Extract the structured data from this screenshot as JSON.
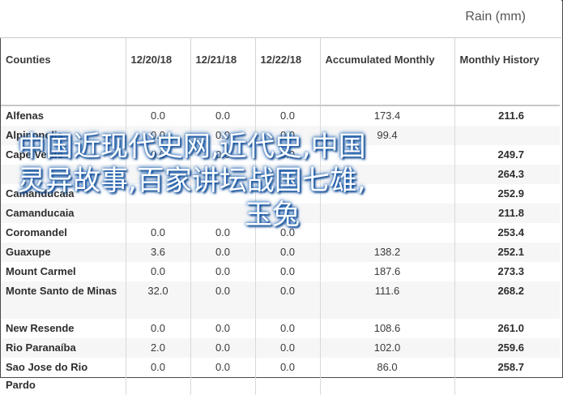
{
  "header": {
    "title": "Rain (mm)"
  },
  "table": {
    "columns": [
      "Counties",
      "12/20/18",
      "12/21/18",
      "12/22/18",
      "Accumulated Monthly",
      "Monthly History"
    ],
    "rows": [
      {
        "county": "Alfenas",
        "d1": "0.0",
        "d2": "0.0",
        "d3": "0.0",
        "acc": "173.4",
        "hist": "211.6"
      },
      {
        "county": "Alpinopolis",
        "d1": "0.0",
        "d2": "0.0",
        "d3": "0.0",
        "acc": "99.4",
        "hist": ""
      },
      {
        "county": "Cape Verde",
        "d1": "0.0",
        "d2": "0.0",
        "d3": "0.0",
        "acc": "",
        "hist": "249.7"
      },
      {
        "county": "",
        "d1": "",
        "d2": "",
        "d3": "",
        "acc": "",
        "hist": "264.3"
      },
      {
        "county": "Camanducaia",
        "d1": "",
        "d2": "",
        "d3": "",
        "acc": "",
        "hist": "252.9"
      },
      {
        "county": "Camanducaia",
        "d1": "",
        "d2": "",
        "d3": "",
        "acc": "",
        "hist": "211.8"
      },
      {
        "county": "Coromandel",
        "d1": "0.0",
        "d2": "0.0",
        "d3": "0.0",
        "acc": "",
        "hist": "253.4"
      },
      {
        "county": "Guaxupe",
        "d1": "3.6",
        "d2": "0.0",
        "d3": "0.0",
        "acc": "138.2",
        "hist": "252.1"
      },
      {
        "county": "Mount Carmel",
        "d1": "0.0",
        "d2": "0.0",
        "d3": "0.0",
        "acc": "187.6",
        "hist": "273.3"
      },
      {
        "county": "Monte Santo de Minas",
        "d1": "32.0",
        "d2": "0.0",
        "d3": "0.0",
        "acc": "111.6",
        "hist": "268.2"
      },
      {
        "county": "New Resende",
        "d1": "0.0",
        "d2": "0.0",
        "d3": "0.0",
        "acc": "108.6",
        "hist": "261.0"
      },
      {
        "county": "Rio Paranaíba",
        "d1": "2.0",
        "d2": "0.0",
        "d3": "0.0",
        "acc": "102.0",
        "hist": "259.6"
      },
      {
        "county": "Sao Jose do Rio Pardo",
        "d1": "0.0",
        "d2": "0.0",
        "d3": "0.0",
        "acc": "86.0",
        "hist": "258.7"
      }
    ]
  },
  "overlay": {
    "line1": "中国近现代史网,近代史,中国",
    "line2": "灵异故事,百家讲坛战国七雄,",
    "line3": "玉兔"
  }
}
